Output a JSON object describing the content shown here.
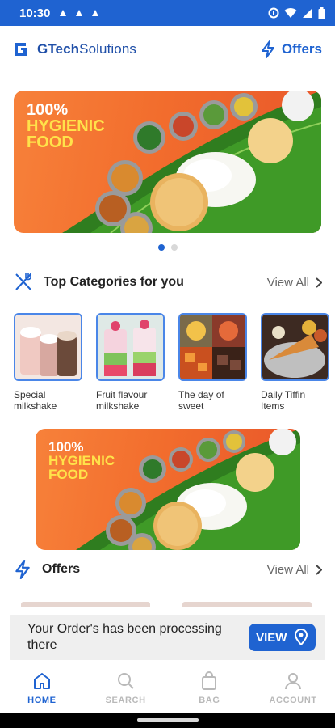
{
  "status_bar": {
    "time": "10:30"
  },
  "app": {
    "brand_prefix": "GTech",
    "brand_suffix": "Solutions",
    "offers_label": "Offers"
  },
  "banner": {
    "line1": "100%",
    "line2": "HYGIENIC",
    "line3": "FOOD"
  },
  "carousel": {
    "count": 2,
    "active_index": 0
  },
  "top_categories": {
    "title": "Top Categories for you",
    "view_all": "View All",
    "items": [
      {
        "label": "Special milkshake"
      },
      {
        "label": "Fruit flavour milkshake"
      },
      {
        "label": "The day of sweet"
      },
      {
        "label": "Daily Tiffin Items"
      }
    ]
  },
  "offers_section": {
    "title": "Offers",
    "view_all": "View All"
  },
  "order_status": {
    "message": "Your Order's has been processing there",
    "button_label": "VIEW"
  },
  "tabs": [
    {
      "label": "HOME",
      "icon": "home-icon",
      "active": true
    },
    {
      "label": "SEARCH",
      "icon": "search-icon",
      "active": false
    },
    {
      "label": "BAG",
      "icon": "bag-icon",
      "active": false
    },
    {
      "label": "ACCOUNT",
      "icon": "account-icon",
      "active": false
    }
  ],
  "colors": {
    "primary": "#1f63d1",
    "banner_orange": "#f26d2d",
    "banner_yellow": "#ffe24a"
  }
}
